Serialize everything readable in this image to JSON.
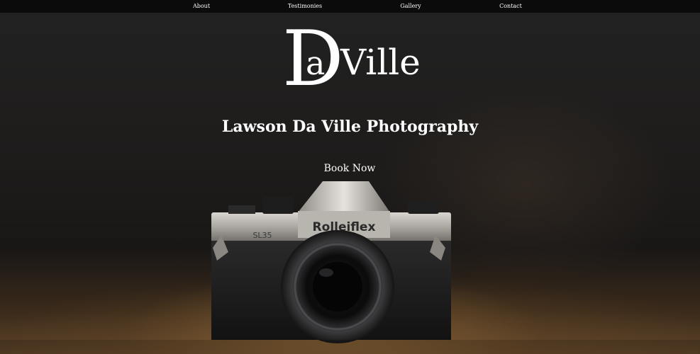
{
  "nav": {
    "items": [
      {
        "label": "About"
      },
      {
        "label": "Testimonies"
      },
      {
        "label": "Gallery"
      },
      {
        "label": "Contact"
      }
    ]
  },
  "logo": {
    "big_letter": "D",
    "small_letter": "a",
    "rest": "Ville"
  },
  "hero": {
    "title": "Lawson Da Ville Photography",
    "cta_label": "Book Now",
    "camera_brand": "Rolleiflex",
    "camera_model": "SL35"
  },
  "colors": {
    "nav_bg": "#0b0b0b",
    "text": "#ffffff"
  }
}
